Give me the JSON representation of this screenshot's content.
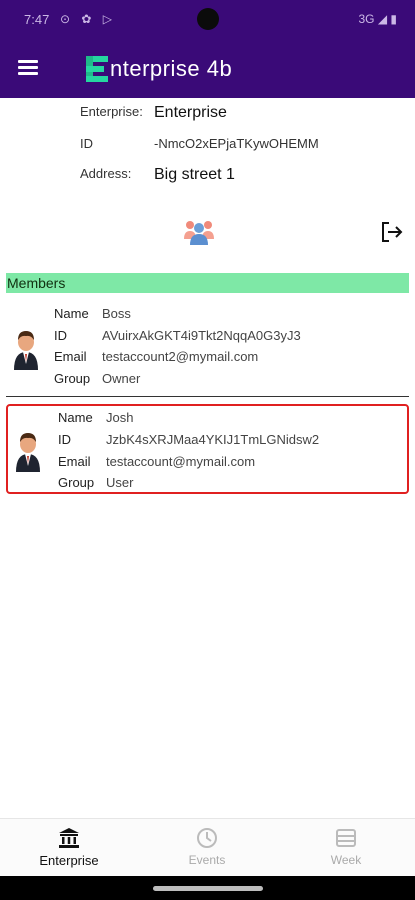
{
  "status_bar": {
    "time": "7:47",
    "icons": "⊙ ✿ ▷",
    "right": "3G ◢ ▮"
  },
  "app": {
    "title": "nterprise 4b"
  },
  "enterprise": {
    "name_label": "Enterprise:",
    "name_value": "Enterprise",
    "id_label": "ID",
    "id_value": "-NmcO2xEPjaTKywOHEMM",
    "address_label": "Address:",
    "address_value": "Big street 1"
  },
  "members_section": {
    "title": "Members"
  },
  "labels": {
    "name": "Name",
    "id": "ID",
    "email": "Email",
    "group": "Group"
  },
  "members": [
    {
      "name": "Boss",
      "id": "AVuirxAkGKT4i9Tkt2NqqA0G3yJ3",
      "email": "testaccount2@mymail.com",
      "group": "Owner"
    },
    {
      "name": "Josh",
      "id": "JzbK4sXRJMaa4YKIJ1TmLGNidsw2",
      "email": "testaccount@mymail.com",
      "group": "User"
    }
  ],
  "bottom_nav": [
    {
      "label": "Enterprise",
      "icon": "bank-icon",
      "active": true
    },
    {
      "label": "Events",
      "icon": "clock-icon",
      "active": false
    },
    {
      "label": "Week",
      "icon": "week-icon",
      "active": false
    }
  ],
  "colors": {
    "app_bar": "#3a0a78",
    "section_bar": "#7ee8a6",
    "selection": "#e02020",
    "logo": "#25d6a0"
  }
}
